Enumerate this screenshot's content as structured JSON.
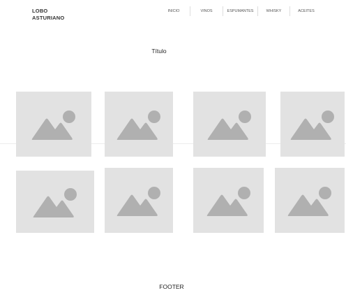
{
  "header": {
    "logo_line1": "LOBO",
    "logo_line2": "ASTURIANO",
    "nav": [
      {
        "label": "INICIO"
      },
      {
        "label": "VINOS"
      },
      {
        "label": "ESPUMANTES"
      },
      {
        "label": "WHISKY"
      },
      {
        "label": "ACEITES"
      }
    ]
  },
  "main": {
    "title": "Título",
    "gallery": [
      {
        "icon": "image-placeholder-icon"
      },
      {
        "icon": "image-placeholder-icon"
      },
      {
        "icon": "image-placeholder-icon"
      },
      {
        "icon": "image-placeholder-icon"
      },
      {
        "icon": "image-placeholder-icon"
      },
      {
        "icon": "image-placeholder-icon"
      },
      {
        "icon": "image-placeholder-icon"
      },
      {
        "icon": "image-placeholder-icon"
      }
    ]
  },
  "footer": {
    "label": "FOOTER"
  },
  "colors": {
    "placeholder_bg": "#e2e2e2",
    "placeholder_icon": "#b0b0b0"
  }
}
